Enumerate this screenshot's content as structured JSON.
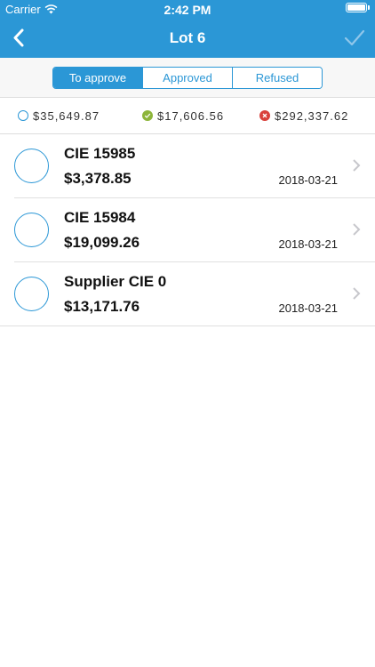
{
  "status": {
    "carrier": "Carrier",
    "time": "2:42 PM"
  },
  "nav": {
    "title": "Lot 6"
  },
  "tabs": [
    "To approve",
    "Approved",
    "Refused"
  ],
  "summary": {
    "pending": "$35,649.87",
    "approved": "$17,606.56",
    "refused": "$292,337.62"
  },
  "items": [
    {
      "name": "CIE 15985",
      "amount": "$3,378.85",
      "date": "2018-03-21"
    },
    {
      "name": "CIE 15984",
      "amount": "$19,099.26",
      "date": "2018-03-21"
    },
    {
      "name": "Supplier CIE 0",
      "amount": "$13,171.76",
      "date": "2018-03-21"
    }
  ],
  "colors": {
    "accent": "#2b97d6",
    "approved": "#8db53a",
    "refused": "#d9413b"
  },
  "icons": {
    "back": "chevron-left-icon",
    "confirm": "checkmark-icon",
    "row": "chevron-right-icon"
  }
}
